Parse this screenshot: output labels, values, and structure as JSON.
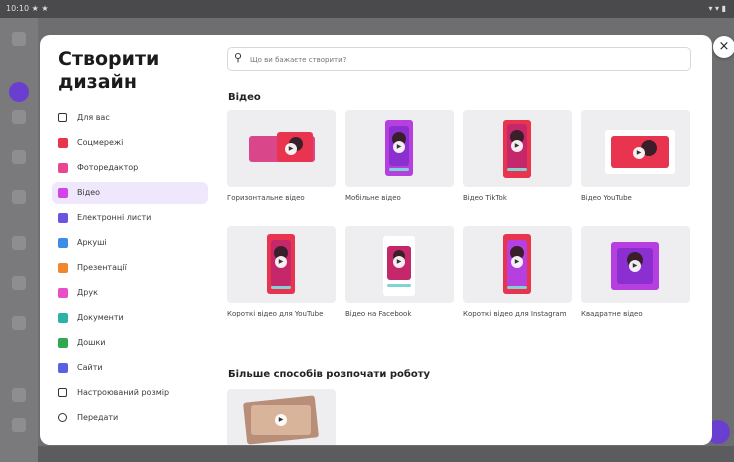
{
  "statusbar": {
    "left": "10:10 ★ ★",
    "right": "▾ ▾ ▮"
  },
  "close_icon": "×",
  "modal": {
    "title": "Створити дизайн",
    "search": {
      "icon": "search-icon",
      "placeholder": "Що ви бажаєте створити?",
      "value": ""
    },
    "sidebar": {
      "items": [
        {
          "label": "Для вас",
          "icon": "sparkle-icon",
          "color": "#333333",
          "active": false
        },
        {
          "label": "Соцмережі",
          "icon": "heart-icon",
          "color": "#e8344e",
          "active": false
        },
        {
          "label": "Фоторедактор",
          "icon": "photo-icon",
          "color": "#e8468f",
          "active": false
        },
        {
          "label": "Відео",
          "icon": "video-icon",
          "color": "#d344e8",
          "active": true
        },
        {
          "label": "Електронні листи",
          "icon": "email-icon",
          "color": "#6a55e0",
          "active": false
        },
        {
          "label": "Аркуші",
          "icon": "sheet-icon",
          "color": "#3d8de8",
          "active": false
        },
        {
          "label": "Презентації",
          "icon": "presentation-icon",
          "color": "#f0872e",
          "active": false
        },
        {
          "label": "Друк",
          "icon": "print-icon",
          "color": "#e84ec8",
          "active": false
        },
        {
          "label": "Документи",
          "icon": "document-icon",
          "color": "#2bb3a8",
          "active": false
        },
        {
          "label": "Дошки",
          "icon": "whiteboard-icon",
          "color": "#2fa84f",
          "active": false
        },
        {
          "label": "Сайти",
          "icon": "website-icon",
          "color": "#5b5fe0",
          "active": false
        },
        {
          "label": "Настроюваний розмір",
          "icon": "custom-size-icon",
          "color": "#333333",
          "active": false
        },
        {
          "label": "Передати",
          "icon": "upload-icon",
          "color": "#333333",
          "active": false
        }
      ]
    },
    "video_section": {
      "title": "Відео",
      "cards": [
        {
          "label": "Горизонтальне відео",
          "kind": "horizontal"
        },
        {
          "label": "Мобільне відео",
          "kind": "mobile"
        },
        {
          "label": "Відео TikTok",
          "kind": "tiktok"
        },
        {
          "label": "Відео YouTube",
          "kind": "youtube"
        },
        {
          "label": "Короткі відео для YouTube",
          "kind": "shorts"
        },
        {
          "label": "Відео на Facebook",
          "kind": "facebook"
        },
        {
          "label": "Короткі відео для Instagram",
          "kind": "instagram"
        },
        {
          "label": "Квадратне відео",
          "kind": "square"
        }
      ]
    },
    "more_section": {
      "title": "Більше способів розпочати роботу"
    }
  }
}
